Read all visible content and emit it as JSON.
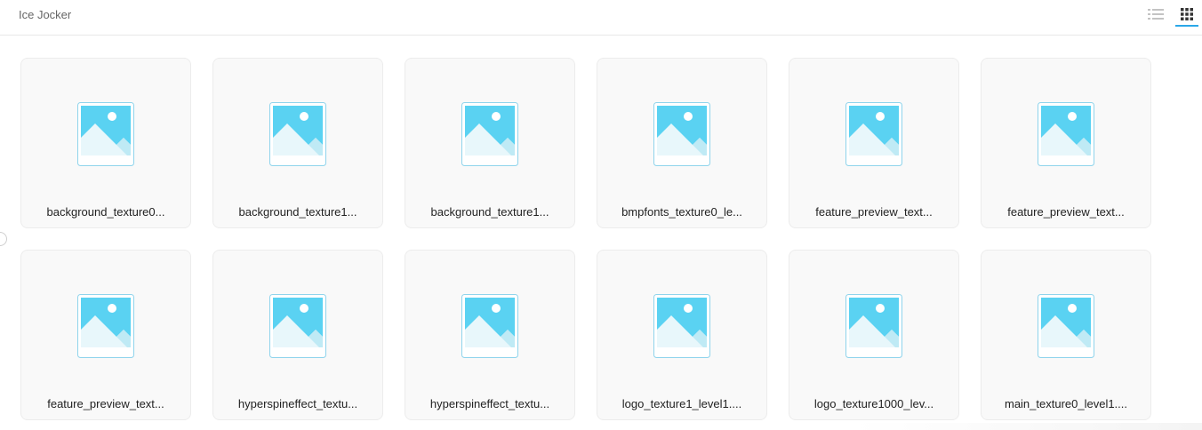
{
  "header": {
    "title": "Ice Jocker",
    "list_view_icon": "list-view-icon",
    "grid_view_icon": "grid-view-icon",
    "accent_color": "#2aa7e8"
  },
  "files": [
    {
      "name": "background_texture0...",
      "icon": "image-file-icon"
    },
    {
      "name": "background_texture1...",
      "icon": "image-file-icon"
    },
    {
      "name": "background_texture1...",
      "icon": "image-file-icon"
    },
    {
      "name": "bmpfonts_texture0_le...",
      "icon": "image-file-icon"
    },
    {
      "name": "feature_preview_text...",
      "icon": "image-file-icon"
    },
    {
      "name": "feature_preview_text...",
      "icon": "image-file-icon"
    },
    {
      "name": "feature_preview_text...",
      "icon": "image-file-icon"
    },
    {
      "name": "hyperspineffect_textu...",
      "icon": "image-file-icon"
    },
    {
      "name": "hyperspineffect_textu...",
      "icon": "image-file-icon"
    },
    {
      "name": "logo_texture1_level1....",
      "icon": "image-file-icon"
    },
    {
      "name": "logo_texture1000_lev...",
      "icon": "image-file-icon"
    },
    {
      "name": "main_texture0_level1....",
      "icon": "image-file-icon"
    }
  ]
}
